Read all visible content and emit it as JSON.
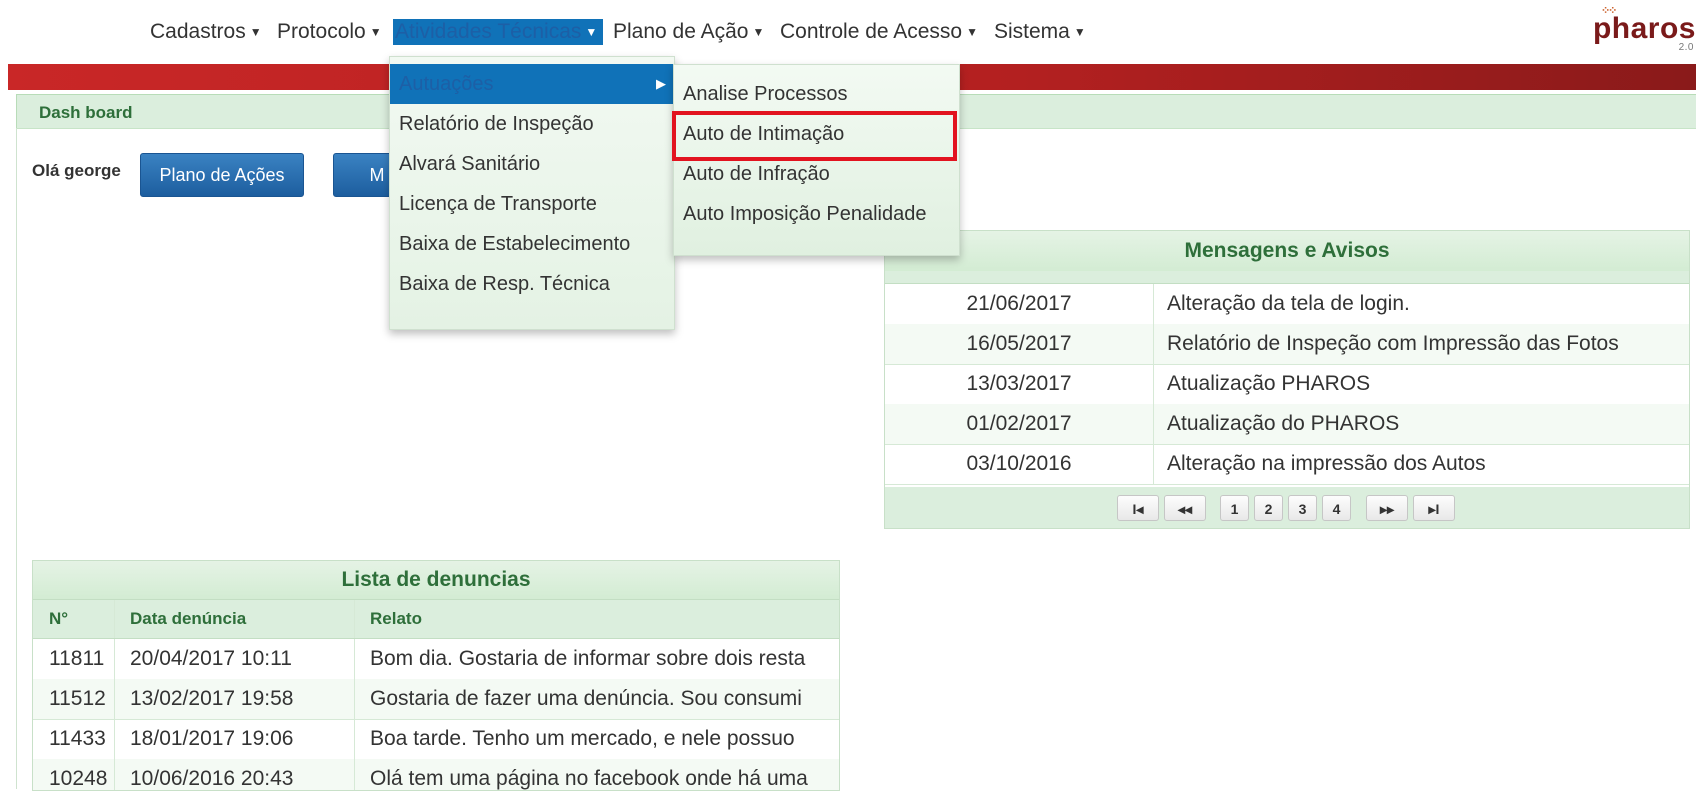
{
  "nav": {
    "items": [
      {
        "label": "Cadastros"
      },
      {
        "label": "Protocolo"
      },
      {
        "label": "Atividades Técnicas"
      },
      {
        "label": "Plano de Ação"
      },
      {
        "label": "Controle de Acesso"
      },
      {
        "label": "Sistema"
      }
    ],
    "logo_text": "pharos",
    "logo_version": "2.0"
  },
  "dashboard": {
    "title": "Dash board",
    "greeting": "Olá george",
    "buttons": [
      "Plano de Ações",
      "M"
    ]
  },
  "menu": {
    "items": [
      "Autuações",
      "Relatório de Inspeção",
      "Alvará Sanitário",
      "Licença de Transporte",
      "Baixa de Estabelecimento",
      "Baixa de Resp. Técnica"
    ],
    "submenu": [
      "Analise Processos",
      "Auto de Intimação",
      "Auto de Infração",
      "Auto Imposição Penalidade"
    ],
    "highlight_color": "#e2131f",
    "active_color": "#1072b8"
  },
  "messages": {
    "title": "Mensagens e Avisos",
    "rows": [
      {
        "date": "21/06/2017",
        "text": "Alteração da tela de login."
      },
      {
        "date": "16/05/2017",
        "text": "Relatório de Inspeção com Impressão das Fotos"
      },
      {
        "date": "13/03/2017",
        "text": "Atualização PHAROS"
      },
      {
        "date": "01/02/2017",
        "text": "Atualização do PHAROS"
      },
      {
        "date": "03/10/2016",
        "text": "Alteração na impressão dos Autos"
      }
    ],
    "pager": {
      "pages": [
        "1",
        "2",
        "3",
        "4"
      ],
      "first": "I◂",
      "prev": "◂◂",
      "next": "▸▸",
      "last": "▸I"
    }
  },
  "denuncias": {
    "title": "Lista de denuncias",
    "headers": [
      "N°",
      "Data denúncia",
      "Relato"
    ],
    "rows": [
      {
        "num": "11811",
        "date": "20/04/2017 10:11",
        "relato": "Bom dia. Gostaria de informar sobre dois resta"
      },
      {
        "num": "11512",
        "date": "13/02/2017 19:58",
        "relato": "Gostaria de fazer uma denúncia. Sou consumi"
      },
      {
        "num": "11433",
        "date": "18/01/2017 19:06",
        "relato": "Boa tarde. Tenho um mercado, e nele possuo"
      },
      {
        "num": "10248",
        "date": "10/06/2016 20:43",
        "relato": "Olá tem uma página no facebook onde há uma"
      }
    ]
  }
}
